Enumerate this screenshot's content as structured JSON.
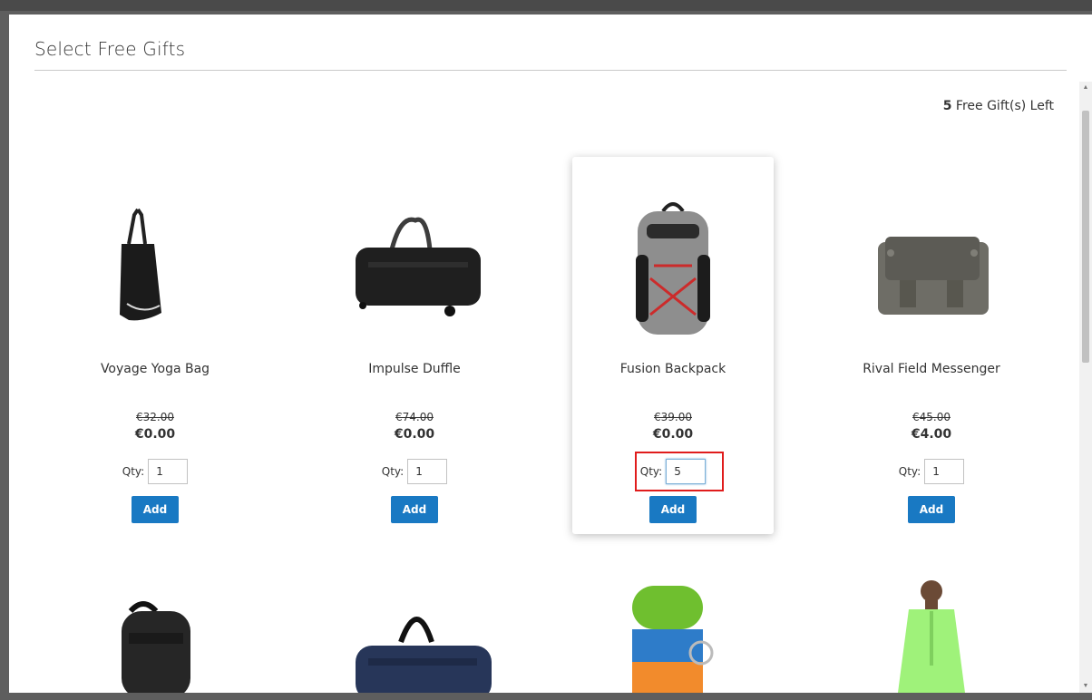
{
  "modal": {
    "title": "Select Free Gifts",
    "gifts_left_count": "5",
    "gifts_left_text": "Free Gift(s) Left"
  },
  "products": [
    {
      "name": "Voyage Yoga Bag",
      "old_price": "€32.00",
      "price": "€0.00",
      "qty_label": "Qty:",
      "qty": "1",
      "add_label": "Add",
      "image_icon": "tote-bag-icon"
    },
    {
      "name": "Impulse Duffle",
      "old_price": "€74.00",
      "price": "€0.00",
      "qty_label": "Qty:",
      "qty": "1",
      "add_label": "Add",
      "image_icon": "duffle-bag-icon"
    },
    {
      "name": "Fusion Backpack",
      "old_price": "€39.00",
      "price": "€0.00",
      "qty_label": "Qty:",
      "qty": "5",
      "add_label": "Add",
      "image_icon": "backpack-icon"
    },
    {
      "name": "Rival Field Messenger",
      "old_price": "€45.00",
      "price": "€4.00",
      "qty_label": "Qty:",
      "qty": "1",
      "add_label": "Add",
      "image_icon": "messenger-bag-icon"
    }
  ],
  "second_row_images": [
    "black-backpack-icon",
    "navy-duffle-icon",
    "yoga-strap-icon",
    "green-jacket-icon"
  ],
  "colors": {
    "accent": "#1979c3",
    "highlight": "#e01c1c"
  }
}
